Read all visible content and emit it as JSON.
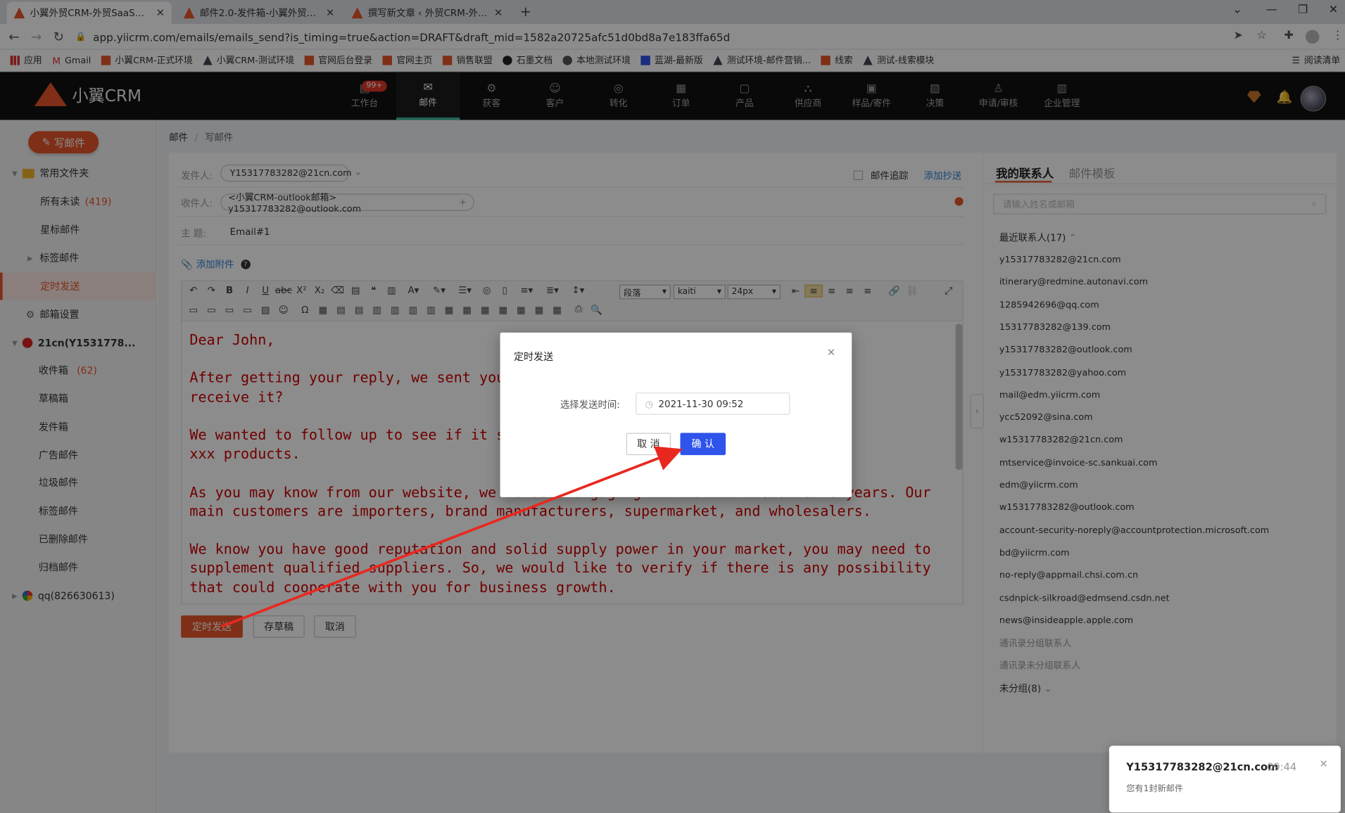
{
  "browser": {
    "tabs": [
      {
        "title": "小翼外贸CRM-外贸SaaS客户管理系统",
        "active": true
      },
      {
        "title": "邮件2.0-发件箱-小翼外贸CRM",
        "active": false
      },
      {
        "title": "撰写新文章 ‹ 外贸CRM-外贸管理软件",
        "active": false
      }
    ],
    "url": "app.yiicrm.com/emails/emails_send?is_timing=true&action=DRAFT&draft_mid=1582a20725afc51d0bd8a7e183ffa65d",
    "bookmarks": [
      "应用",
      "Gmail",
      "小翼CRM-正式环境",
      "小翼CRM-测试环境",
      "官网后台登录",
      "官网主页",
      "销售联盟",
      "石墨文档",
      "本地测试环境",
      "蓝湖-最新版",
      "测试环境-邮件营销...",
      "线索",
      "测试-线索模块"
    ],
    "reading_list": "阅读清单"
  },
  "app": {
    "logo": "小翼CRM",
    "badge": "99+",
    "nav": [
      "工作台",
      "邮件",
      "获客",
      "客户",
      "转化",
      "订单",
      "产品",
      "供应商",
      "样品/寄件",
      "决策",
      "申请/审核",
      "企业管理"
    ],
    "active_nav": "邮件"
  },
  "sidebar": {
    "compose": "写邮件",
    "folders_title": "常用文件夹",
    "unread": "所有未读",
    "unread_count": "(419)",
    "starred": "星标邮件",
    "tagged": "标签邮件",
    "scheduled": "定时发送",
    "settings": "邮箱设置",
    "account1": "21cn(Y1531778...",
    "inbox": "收件箱",
    "inbox_count": "(62)",
    "drafts": "草稿箱",
    "sent": "发件箱",
    "ads": "广告邮件",
    "spam": "垃圾邮件",
    "tag_mail": "标签邮件",
    "deleted": "已删除邮件",
    "archived": "归档邮件",
    "account2": "qq(826630613)"
  },
  "breadcrumb": {
    "root": "邮件",
    "sep": "/",
    "current": "写邮件"
  },
  "compose": {
    "from_label": "发件人:",
    "from_value": "Y15317783282@21cn.com",
    "track_label": "邮件追踪",
    "add_cc": "添加抄送",
    "to_label": "收件人:",
    "to_value": "<小翼CRM-outlook邮箱> y15317783282@outlook.com",
    "subject_label": "主 题:",
    "subject_value": "Email#1",
    "attach": "添加附件",
    "para_select": "段落",
    "font_select": "kaiti",
    "size_select": "24px",
    "body": "Dear John,\n\nAfter getting your reply, we sent you a catalog of our products, did you\nreceive it?\n\nWe wanted to follow up to see if it suited your needs. Here is a list of our\nxxx products.\n\nAs you may know from our website, we've been engaging in the xxx field for 8 years. Our\nmain customers are importers, brand manufacturers, supermarket, and wholesalers.\n\nWe know you have good reputation and solid supply power in your market, you may need to\nsupplement qualified suppliers. So, we would like to verify if there is any possibility\nthat could cooperate with you for business growth.",
    "btn_schedule": "定时发送",
    "btn_draft": "存草稿",
    "btn_cancel": "取消"
  },
  "right_panel": {
    "tab_contacts": "我的联系人",
    "tab_templates": "邮件模板",
    "search_placeholder": "请输入姓名或邮箱",
    "recent": "最近联系人(17)",
    "contacts": [
      "y15317783282@21cn.com",
      "itinerary@redmine.autonavi.com",
      "1285942696@qq.com",
      "15317783282@139.com",
      "y15317783282@outlook.com",
      "y15317783282@yahoo.com",
      "mail@edm.yiicrm.com",
      "ycc52092@sina.com",
      "w15317783282@21cn.com",
      "mtservice@invoice-sc.sankuai.com",
      "edm@yiicrm.com",
      "w15317783282@outlook.com",
      "account-security-noreply@accountprotection.microsoft.com",
      "bd@yiicrm.com",
      "no-reply@appmail.chsi.com.cn",
      "csdnpick-silkroad@edmsend.csdn.net",
      "news@insideapple.apple.com"
    ],
    "group_contacts": "通讯录分组联系人",
    "ungrouped_contacts": "通讯录未分组联系人",
    "ungrouped": "未分组(8)"
  },
  "dialog": {
    "title": "定时发送",
    "label": "选择发送时间:",
    "value": "2021-11-30 09:52",
    "cancel": "取 消",
    "confirm": "确 认"
  },
  "toast": {
    "sender": "Y15317783282@21cn.com",
    "time": "09:44",
    "message": "您有1封新邮件"
  },
  "colors": {
    "brand": "#e8562a",
    "primary_blue": "#2f54eb",
    "nav_active": "#3bb79a"
  }
}
